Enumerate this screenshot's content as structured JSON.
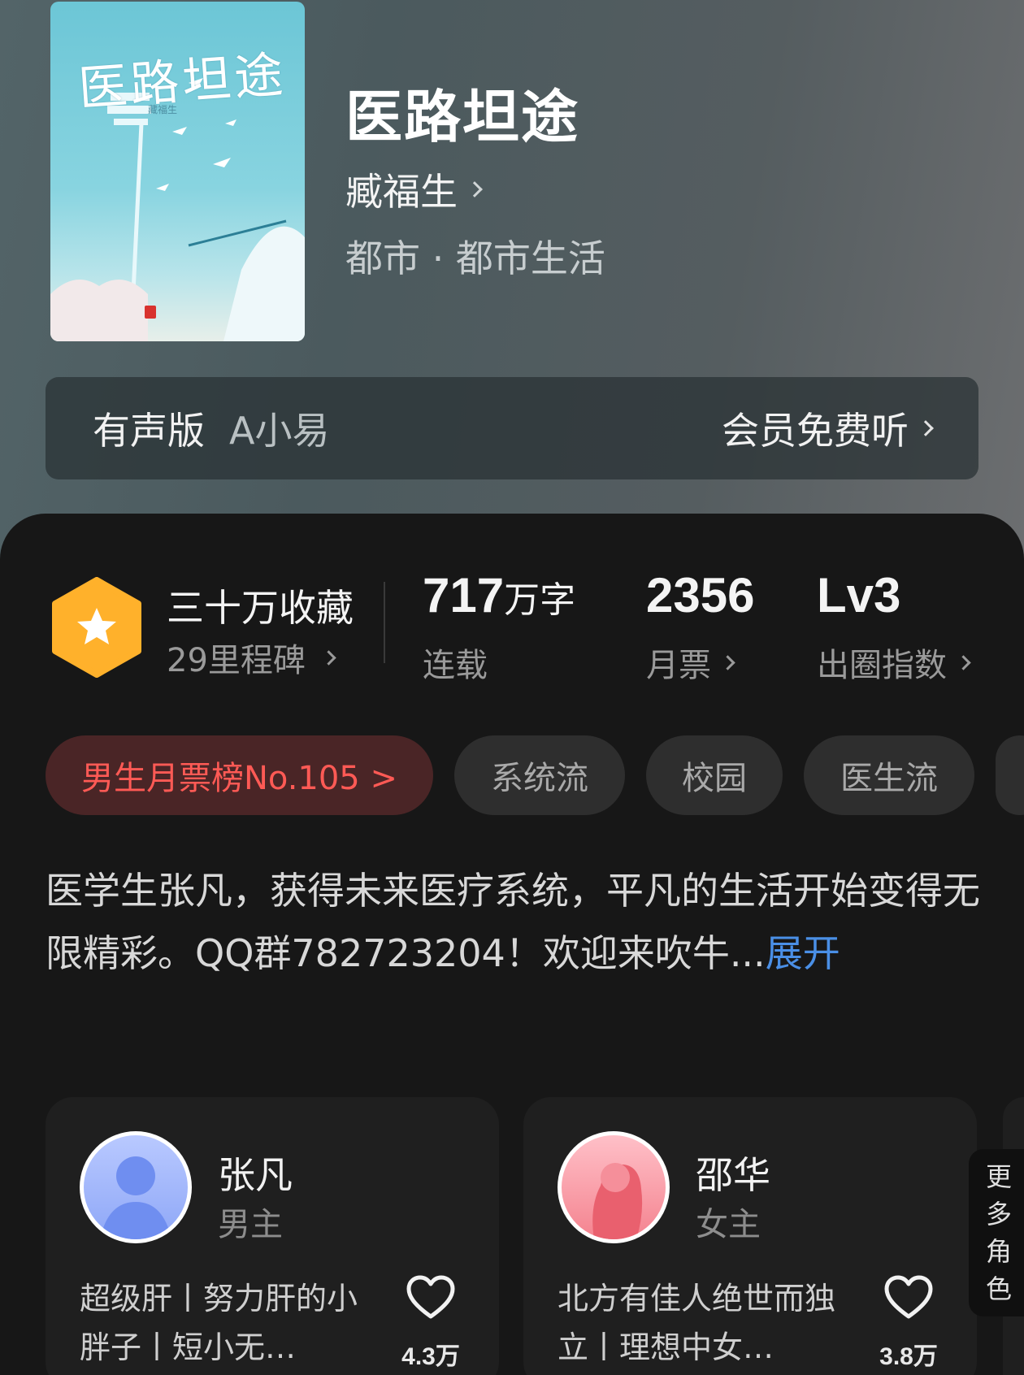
{
  "book": {
    "cover_title": "医路坦途",
    "cover_author": "藏福生",
    "title": "医路坦途",
    "author": "臧福生",
    "genre": "都市 · 都市生活"
  },
  "audio": {
    "label": "有声版",
    "narrator": "A小易",
    "action": "会员免费听"
  },
  "stats": {
    "collection_title": "三十万收藏",
    "collection_sub": "29里程碑",
    "words_value": "717",
    "words_unit": "万字",
    "words_sub": "连载",
    "ticket_value": "2356",
    "ticket_sub": "月票",
    "level_value": "Lv3",
    "level_sub": "出圈指数"
  },
  "tags": [
    "男生月票榜No.105 >",
    "系统流",
    "校园",
    "医生流"
  ],
  "synopsis": {
    "text": "医学生张凡，获得未来医疗系统，平凡的生活开始变得无限精彩。QQ群782723204！欢迎来吹牛...",
    "expand": "展开"
  },
  "roles": [
    {
      "name": "张凡",
      "type": "男主",
      "desc": "超级肝丨努力肝的小胖子丨短小无…",
      "likes": "4.3万"
    },
    {
      "name": "邵华",
      "type": "女主",
      "desc": "北方有佳人绝世而独立丨理想中女…",
      "likes": "3.8万"
    }
  ],
  "more_roles": "更多角色",
  "colors": {
    "rank_text": "#ff5a55",
    "rank_bg": "#4a2526",
    "expand_link": "#4a8fe6",
    "badge": "#ffb12b"
  }
}
